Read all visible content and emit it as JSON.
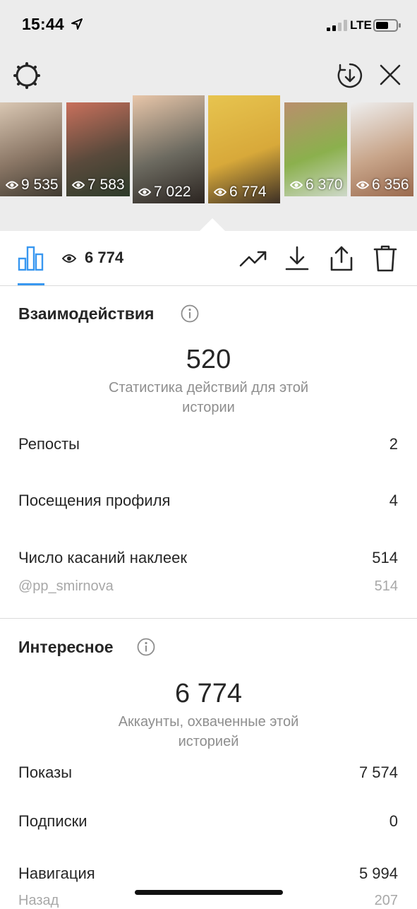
{
  "status_bar": {
    "time": "15:44",
    "network": "LTE"
  },
  "stories": [
    {
      "views": "9 535",
      "colors": [
        "#d9c7b3",
        "#8b7766",
        "#3f3a30"
      ]
    },
    {
      "views": "7 583",
      "colors": [
        "#c9705c",
        "#5a4a3c",
        "#2d3b2a"
      ]
    },
    {
      "views": "7 022",
      "colors": [
        "#e8c6a9",
        "#6c6a60",
        "#2b2420"
      ],
      "selected": false
    },
    {
      "views": "6 774",
      "colors": [
        "#e7c44f",
        "#d8a93a",
        "#3c2f25"
      ],
      "selected": true
    },
    {
      "views": "6 370",
      "colors": [
        "#b98f6c",
        "#8bb04d",
        "#cdd8c8"
      ]
    },
    {
      "views": "6 356",
      "colors": [
        "#eeeeee",
        "#c8a58a",
        "#9a6a4e"
      ]
    }
  ],
  "toolbar": {
    "views_count": "6 774"
  },
  "interactions": {
    "title": "Взаимодействия",
    "total": "520",
    "caption_line1": "Статистика действий для этой",
    "caption_line2": "истории",
    "rows": [
      {
        "label": "Репосты",
        "value": "2"
      },
      {
        "label": "Посещения профиля",
        "value": "4"
      },
      {
        "label": "Число касаний наклеек",
        "value": "514"
      }
    ],
    "sub_row": {
      "label": "@pp_smirnova",
      "value": "514"
    }
  },
  "discovery": {
    "title": "Интересное",
    "total": "6 774",
    "caption_line1": "Аккаунты, охваченные этой",
    "caption_line2": "историей",
    "rows": [
      {
        "label": "Показы",
        "value": "7 574"
      },
      {
        "label": "Подписки",
        "value": "0"
      },
      {
        "label": "Навигация",
        "value": "5 994"
      }
    ],
    "sub_row": {
      "label": "Назад",
      "value": "207"
    }
  },
  "colors": {
    "accent": "#3897f0",
    "text": "#262626",
    "secondary": "#8e8e8e"
  }
}
